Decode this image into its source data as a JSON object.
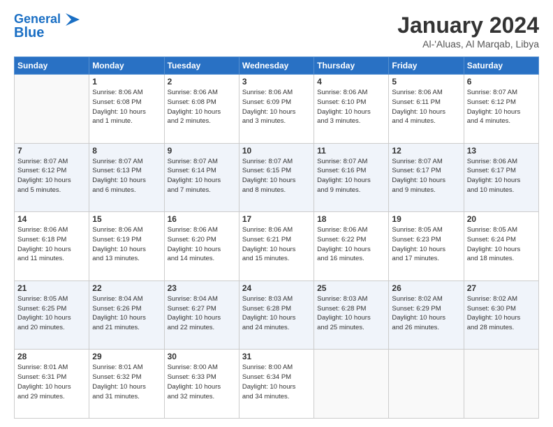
{
  "header": {
    "logo_line1": "General",
    "logo_line2": "Blue",
    "title": "January 2024",
    "subtitle": "Al-'Aluas, Al Marqab, Libya"
  },
  "weekdays": [
    "Sunday",
    "Monday",
    "Tuesday",
    "Wednesday",
    "Thursday",
    "Friday",
    "Saturday"
  ],
  "weeks": [
    [
      {
        "day": "",
        "info": ""
      },
      {
        "day": "1",
        "info": "Sunrise: 8:06 AM\nSunset: 6:08 PM\nDaylight: 10 hours\nand 1 minute."
      },
      {
        "day": "2",
        "info": "Sunrise: 8:06 AM\nSunset: 6:08 PM\nDaylight: 10 hours\nand 2 minutes."
      },
      {
        "day": "3",
        "info": "Sunrise: 8:06 AM\nSunset: 6:09 PM\nDaylight: 10 hours\nand 3 minutes."
      },
      {
        "day": "4",
        "info": "Sunrise: 8:06 AM\nSunset: 6:10 PM\nDaylight: 10 hours\nand 3 minutes."
      },
      {
        "day": "5",
        "info": "Sunrise: 8:06 AM\nSunset: 6:11 PM\nDaylight: 10 hours\nand 4 minutes."
      },
      {
        "day": "6",
        "info": "Sunrise: 8:07 AM\nSunset: 6:12 PM\nDaylight: 10 hours\nand 4 minutes."
      }
    ],
    [
      {
        "day": "7",
        "info": "Sunrise: 8:07 AM\nSunset: 6:12 PM\nDaylight: 10 hours\nand 5 minutes."
      },
      {
        "day": "8",
        "info": "Sunrise: 8:07 AM\nSunset: 6:13 PM\nDaylight: 10 hours\nand 6 minutes."
      },
      {
        "day": "9",
        "info": "Sunrise: 8:07 AM\nSunset: 6:14 PM\nDaylight: 10 hours\nand 7 minutes."
      },
      {
        "day": "10",
        "info": "Sunrise: 8:07 AM\nSunset: 6:15 PM\nDaylight: 10 hours\nand 8 minutes."
      },
      {
        "day": "11",
        "info": "Sunrise: 8:07 AM\nSunset: 6:16 PM\nDaylight: 10 hours\nand 9 minutes."
      },
      {
        "day": "12",
        "info": "Sunrise: 8:07 AM\nSunset: 6:17 PM\nDaylight: 10 hours\nand 9 minutes."
      },
      {
        "day": "13",
        "info": "Sunrise: 8:06 AM\nSunset: 6:17 PM\nDaylight: 10 hours\nand 10 minutes."
      }
    ],
    [
      {
        "day": "14",
        "info": "Sunrise: 8:06 AM\nSunset: 6:18 PM\nDaylight: 10 hours\nand 11 minutes."
      },
      {
        "day": "15",
        "info": "Sunrise: 8:06 AM\nSunset: 6:19 PM\nDaylight: 10 hours\nand 13 minutes."
      },
      {
        "day": "16",
        "info": "Sunrise: 8:06 AM\nSunset: 6:20 PM\nDaylight: 10 hours\nand 14 minutes."
      },
      {
        "day": "17",
        "info": "Sunrise: 8:06 AM\nSunset: 6:21 PM\nDaylight: 10 hours\nand 15 minutes."
      },
      {
        "day": "18",
        "info": "Sunrise: 8:06 AM\nSunset: 6:22 PM\nDaylight: 10 hours\nand 16 minutes."
      },
      {
        "day": "19",
        "info": "Sunrise: 8:05 AM\nSunset: 6:23 PM\nDaylight: 10 hours\nand 17 minutes."
      },
      {
        "day": "20",
        "info": "Sunrise: 8:05 AM\nSunset: 6:24 PM\nDaylight: 10 hours\nand 18 minutes."
      }
    ],
    [
      {
        "day": "21",
        "info": "Sunrise: 8:05 AM\nSunset: 6:25 PM\nDaylight: 10 hours\nand 20 minutes."
      },
      {
        "day": "22",
        "info": "Sunrise: 8:04 AM\nSunset: 6:26 PM\nDaylight: 10 hours\nand 21 minutes."
      },
      {
        "day": "23",
        "info": "Sunrise: 8:04 AM\nSunset: 6:27 PM\nDaylight: 10 hours\nand 22 minutes."
      },
      {
        "day": "24",
        "info": "Sunrise: 8:03 AM\nSunset: 6:28 PM\nDaylight: 10 hours\nand 24 minutes."
      },
      {
        "day": "25",
        "info": "Sunrise: 8:03 AM\nSunset: 6:28 PM\nDaylight: 10 hours\nand 25 minutes."
      },
      {
        "day": "26",
        "info": "Sunrise: 8:02 AM\nSunset: 6:29 PM\nDaylight: 10 hours\nand 26 minutes."
      },
      {
        "day": "27",
        "info": "Sunrise: 8:02 AM\nSunset: 6:30 PM\nDaylight: 10 hours\nand 28 minutes."
      }
    ],
    [
      {
        "day": "28",
        "info": "Sunrise: 8:01 AM\nSunset: 6:31 PM\nDaylight: 10 hours\nand 29 minutes."
      },
      {
        "day": "29",
        "info": "Sunrise: 8:01 AM\nSunset: 6:32 PM\nDaylight: 10 hours\nand 31 minutes."
      },
      {
        "day": "30",
        "info": "Sunrise: 8:00 AM\nSunset: 6:33 PM\nDaylight: 10 hours\nand 32 minutes."
      },
      {
        "day": "31",
        "info": "Sunrise: 8:00 AM\nSunset: 6:34 PM\nDaylight: 10 hours\nand 34 minutes."
      },
      {
        "day": "",
        "info": ""
      },
      {
        "day": "",
        "info": ""
      },
      {
        "day": "",
        "info": ""
      }
    ]
  ]
}
